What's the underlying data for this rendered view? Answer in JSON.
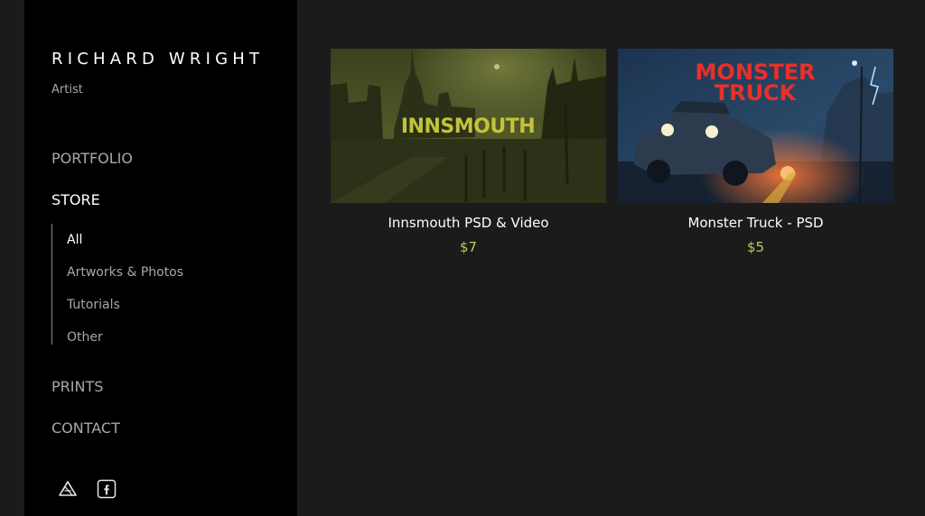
{
  "sidebar": {
    "site_title": "RICHARD WRIGHT",
    "site_subtitle": "Artist",
    "nav": {
      "portfolio": "PORTFOLIO",
      "store": "STORE",
      "prints": "PRINTS",
      "contact": "CONTACT"
    },
    "store_subnav": [
      {
        "label": "All",
        "active": true
      },
      {
        "label": "Artworks & Photos",
        "active": false
      },
      {
        "label": "Tutorials",
        "active": false
      },
      {
        "label": "Other",
        "active": false
      }
    ],
    "social_icons": [
      "artstation-icon",
      "facebook-icon"
    ]
  },
  "products": [
    {
      "title": "Innsmouth PSD & Video",
      "price": "$7",
      "thumb_text": "INNSMOUTH"
    },
    {
      "title": "Monster Truck - PSD",
      "price": "$5",
      "thumb_text_line1": "MONSTER",
      "thumb_text_line2": "TRUCK"
    }
  ],
  "colors": {
    "sidebar_bg": "#000000",
    "page_bg": "#1b1b1b",
    "price": "#c2c95a",
    "muted_text": "#a8a8a8",
    "innsmouth_title": "#c3c33a",
    "monster_truck_title": "#e8302a"
  }
}
